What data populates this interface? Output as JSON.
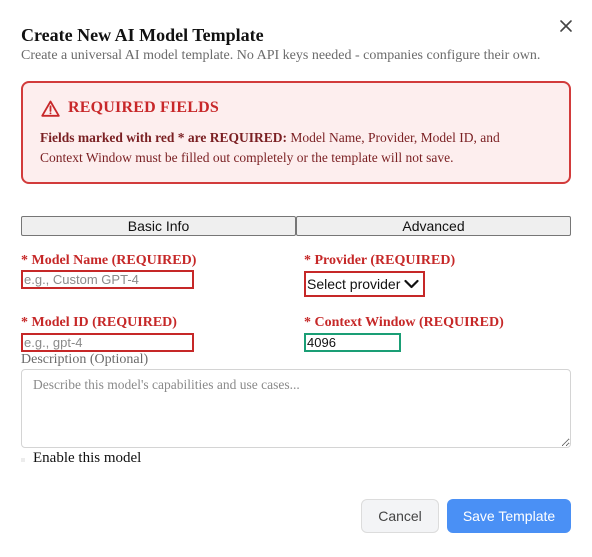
{
  "dialog": {
    "title": "Create New AI Model Template",
    "subtitle": "Create a universal AI model template. No API keys needed - companies configure their own.",
    "close_icon": "close-icon"
  },
  "alert": {
    "icon": "warning-triangle-icon",
    "title": "REQUIRED FIELDS",
    "body_bold": "Fields marked with red * are REQUIRED:",
    "body_text": " Model Name, Provider, Model ID, and Context Window must be filled out completely or the template will not save."
  },
  "tabs": [
    {
      "label": "Basic Info"
    },
    {
      "label": "Advanced"
    }
  ],
  "fields": {
    "model_name": {
      "label": "* Model Name (REQUIRED)",
      "placeholder": "e.g., Custom GPT-4",
      "value": ""
    },
    "provider": {
      "label": "* Provider (REQUIRED)",
      "selected": "Select provider"
    },
    "model_id": {
      "label": "* Model ID (REQUIRED)",
      "placeholder": "e.g., gpt-4",
      "value": ""
    },
    "context_window": {
      "label": "* Context Window (REQUIRED)",
      "value": "4096"
    },
    "description": {
      "label": "Description (Optional)",
      "placeholder": "Describe this model's capabilities and use cases..."
    }
  },
  "enable": {
    "label": "Enable this model"
  },
  "actions": {
    "cancel": "Cancel",
    "save": "Save Template"
  },
  "colors": {
    "required": "#c62828",
    "alert_bg": "#fdeeee",
    "primary": "#4a90f5",
    "valid": "#1a9e75"
  }
}
